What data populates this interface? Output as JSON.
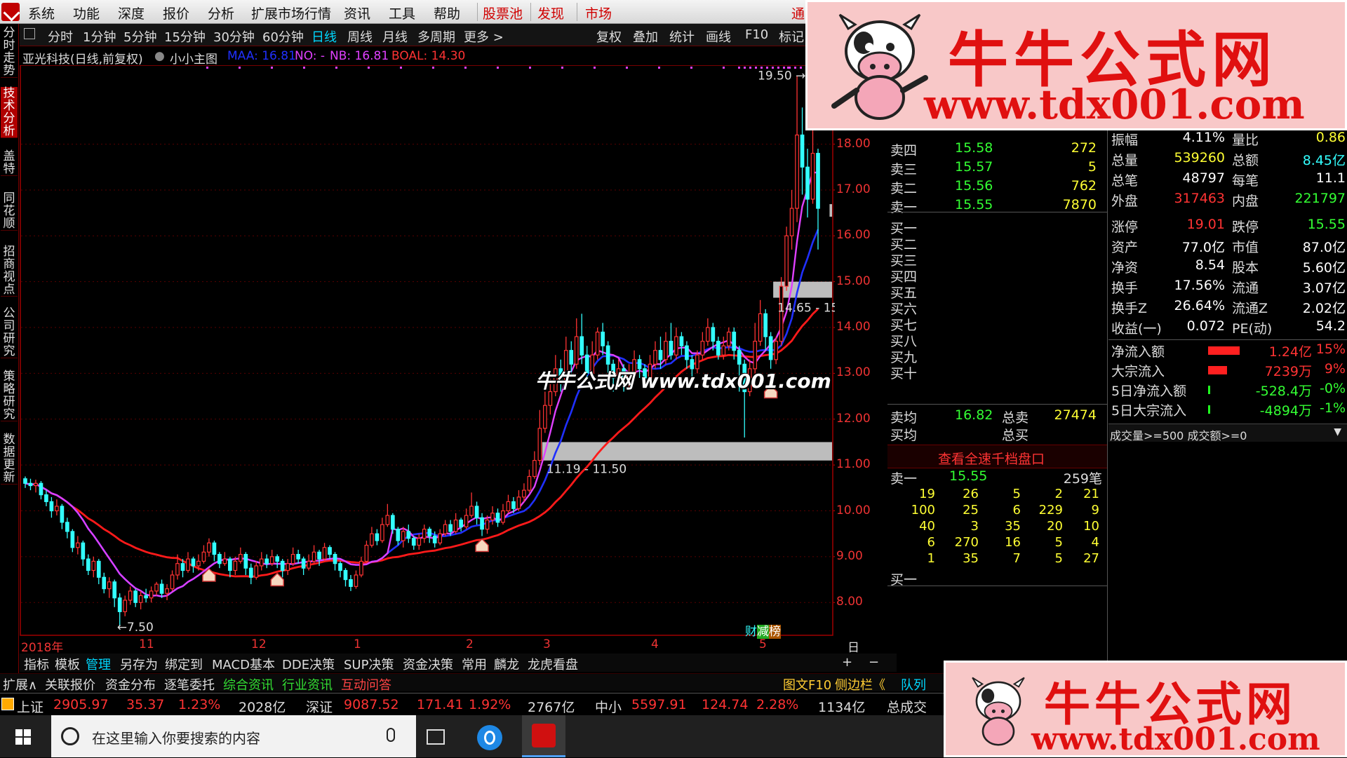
{
  "menu": {
    "items": [
      "系统",
      "功能",
      "深度",
      "报价",
      "分析",
      "扩展市场行情",
      "资讯",
      "工具",
      "帮助"
    ],
    "red_items": [
      "股票池",
      "发现",
      "市场"
    ],
    "right_item": "通"
  },
  "left_tabs": [
    "分时走势",
    "技术分析",
    "盖特",
    "同花顺",
    "招商视点",
    "公司研究",
    "策略研究",
    "数据更新"
  ],
  "period_bar": {
    "items": [
      "分时",
      "1分钟",
      "5分钟",
      "15分钟",
      "30分钟",
      "60分钟",
      "日线",
      "周线",
      "月线",
      "多周期",
      "更多 >"
    ],
    "active": "日线",
    "right_items": [
      "复权",
      "叠加",
      "统计",
      "画线",
      "F10",
      "标记"
    ]
  },
  "chart_title": {
    "stock": "亚光科技(日线,前复权)",
    "indicator": "小小主图",
    "maa": "MAA: 16.81",
    "no": "NO: -",
    "nb": "NB: 16.81",
    "boal": "BOAL: 14.30"
  },
  "colors": {
    "up": "#ff3333",
    "down": "#33ffff",
    "ma_red": "#ff1a1a",
    "ma_blue": "#2030ff",
    "ma_magenta": "#e040ff",
    "zone": "#bdbdbd",
    "accent": "#00d8ff",
    "watermark_red": "#e01010"
  },
  "chart_data": {
    "type": "candlestick",
    "y_axis": {
      "ticks": [
        "18.00",
        "17.00",
        "16.00",
        "15.00",
        "14.00",
        "13.00",
        "12.00",
        "11.00",
        "10.00",
        "9.00",
        "8.00"
      ],
      "range": [
        7.3,
        19.6
      ]
    },
    "x_axis": {
      "labels": [
        "2018年",
        "11",
        "12",
        "1",
        "2",
        "3",
        "4",
        "5"
      ]
    },
    "annotations": {
      "high": "19.50",
      "low": "7.50",
      "zone_low": "11.19 - 11.50",
      "zone_high": "14.65 - 15",
      "last": "16.6"
    },
    "period_label": "日线",
    "candles": [
      [
        10.7,
        10.6,
        10.75,
        10.5
      ],
      [
        10.6,
        10.55,
        10.7,
        10.45
      ],
      [
        10.55,
        10.6,
        10.68,
        10.4
      ],
      [
        10.6,
        10.35,
        10.65,
        10.25
      ],
      [
        10.35,
        10.2,
        10.45,
        10.1
      ],
      [
        10.2,
        10.0,
        10.3,
        9.85
      ],
      [
        10.0,
        10.1,
        10.25,
        9.9
      ],
      [
        10.1,
        9.75,
        10.15,
        9.6
      ],
      [
        9.75,
        9.55,
        9.85,
        9.4
      ],
      [
        9.55,
        9.2,
        9.6,
        9.1
      ],
      [
        9.2,
        9.3,
        9.45,
        9.05
      ],
      [
        9.3,
        8.95,
        9.35,
        8.8
      ],
      [
        8.95,
        8.7,
        9.05,
        8.6
      ],
      [
        8.7,
        8.9,
        9.0,
        8.55
      ],
      [
        8.9,
        8.55,
        8.95,
        8.4
      ],
      [
        8.55,
        8.3,
        8.65,
        8.2
      ],
      [
        8.3,
        8.45,
        8.55,
        8.1
      ],
      [
        8.45,
        8.1,
        8.5,
        7.9
      ],
      [
        8.1,
        7.8,
        8.2,
        7.5
      ],
      [
        7.8,
        8.05,
        8.15,
        7.7
      ],
      [
        8.05,
        8.25,
        8.35,
        7.95
      ],
      [
        8.25,
        8.0,
        8.3,
        7.9
      ],
      [
        8.0,
        8.15,
        8.25,
        7.85
      ],
      [
        8.15,
        8.1,
        8.3,
        8.0
      ],
      [
        8.1,
        8.25,
        8.35,
        8.0
      ],
      [
        8.25,
        8.4,
        8.45,
        8.15
      ],
      [
        8.4,
        8.2,
        8.5,
        8.1
      ],
      [
        8.2,
        8.3,
        8.4,
        8.05
      ],
      [
        8.3,
        8.6,
        8.7,
        8.25
      ],
      [
        8.6,
        8.85,
        9.05,
        8.5
      ],
      [
        8.85,
        8.7,
        8.95,
        8.55
      ],
      [
        8.7,
        8.95,
        9.1,
        8.65
      ],
      [
        8.95,
        8.8,
        9.0,
        8.65
      ],
      [
        8.8,
        8.9,
        9.05,
        8.7
      ],
      [
        8.9,
        9.1,
        9.25,
        8.85
      ],
      [
        9.1,
        9.3,
        9.4,
        9.0
      ],
      [
        9.3,
        9.05,
        9.35,
        8.9
      ],
      [
        9.05,
        8.85,
        9.1,
        8.75
      ],
      [
        8.85,
        8.95,
        9.1,
        8.8
      ],
      [
        8.95,
        8.7,
        9.0,
        8.55
      ],
      [
        8.7,
        8.9,
        9.0,
        8.6
      ],
      [
        8.9,
        9.05,
        9.2,
        8.85
      ],
      [
        9.05,
        8.75,
        9.1,
        8.6
      ],
      [
        8.75,
        8.55,
        8.85,
        8.4
      ],
      [
        8.55,
        8.8,
        8.9,
        8.5
      ],
      [
        8.8,
        8.95,
        9.1,
        8.7
      ],
      [
        8.95,
        8.85,
        9.05,
        8.75
      ],
      [
        8.85,
        9.0,
        9.15,
        8.8
      ],
      [
        9.0,
        8.9,
        9.05,
        8.75
      ],
      [
        8.9,
        8.7,
        8.95,
        8.55
      ],
      [
        8.7,
        8.85,
        8.95,
        8.6
      ],
      [
        8.85,
        9.05,
        9.2,
        8.8
      ],
      [
        9.05,
        8.95,
        9.15,
        8.85
      ],
      [
        8.95,
        8.75,
        9.0,
        8.6
      ],
      [
        8.75,
        8.9,
        9.05,
        8.7
      ],
      [
        8.9,
        9.1,
        9.25,
        8.85
      ],
      [
        9.1,
        8.95,
        9.15,
        8.8
      ],
      [
        8.95,
        9.2,
        9.3,
        8.9
      ],
      [
        9.2,
        9.05,
        9.25,
        8.95
      ],
      [
        9.05,
        8.85,
        9.1,
        8.7
      ],
      [
        8.85,
        8.7,
        8.9,
        8.55
      ],
      [
        8.7,
        8.5,
        8.75,
        8.35
      ],
      [
        8.5,
        8.35,
        8.6,
        8.25
      ],
      [
        8.35,
        8.6,
        8.7,
        8.3
      ],
      [
        8.6,
        8.9,
        9.0,
        8.55
      ],
      [
        8.9,
        9.25,
        9.35,
        8.85
      ],
      [
        9.25,
        9.5,
        9.65,
        9.2
      ],
      [
        9.5,
        9.35,
        9.6,
        9.25
      ],
      [
        9.35,
        9.7,
        9.85,
        9.3
      ],
      [
        9.7,
        9.9,
        10.15,
        9.65
      ],
      [
        9.9,
        9.6,
        9.95,
        9.5
      ],
      [
        9.6,
        9.35,
        9.65,
        9.25
      ],
      [
        9.35,
        9.55,
        9.65,
        9.2
      ],
      [
        9.55,
        9.4,
        9.7,
        9.3
      ],
      [
        9.4,
        9.25,
        9.45,
        9.15
      ],
      [
        9.25,
        9.4,
        9.5,
        9.15
      ],
      [
        9.4,
        9.6,
        9.7,
        9.3
      ],
      [
        9.6,
        9.45,
        9.65,
        9.3
      ],
      [
        9.45,
        9.3,
        9.55,
        9.2
      ],
      [
        9.3,
        9.5,
        9.6,
        9.25
      ],
      [
        9.5,
        9.7,
        9.8,
        9.45
      ],
      [
        9.7,
        9.55,
        9.8,
        9.45
      ],
      [
        9.55,
        9.8,
        9.95,
        9.5
      ],
      [
        9.8,
        9.65,
        9.85,
        9.55
      ],
      [
        9.65,
        9.9,
        10.05,
        9.6
      ],
      [
        9.9,
        10.1,
        10.4,
        9.85
      ],
      [
        10.1,
        9.85,
        10.2,
        9.7
      ],
      [
        9.85,
        9.6,
        9.95,
        9.45
      ],
      [
        9.6,
        9.8,
        9.9,
        9.5
      ],
      [
        9.8,
        9.95,
        10.1,
        9.7
      ],
      [
        9.95,
        9.75,
        10.05,
        9.65
      ],
      [
        9.75,
        10.0,
        10.15,
        9.7
      ],
      [
        10.0,
        10.2,
        10.35,
        9.95
      ],
      [
        10.2,
        10.05,
        10.3,
        9.95
      ],
      [
        10.05,
        10.3,
        10.45,
        10.0
      ],
      [
        10.3,
        10.45,
        10.6,
        10.2
      ],
      [
        10.45,
        10.75,
        10.9,
        10.4
      ],
      [
        10.75,
        11.1,
        11.3,
        10.7
      ],
      [
        11.1,
        11.8,
        12.2,
        11.0
      ],
      [
        11.8,
        12.3,
        12.6,
        11.7
      ],
      [
        12.3,
        12.6,
        12.9,
        12.1
      ],
      [
        12.6,
        13.1,
        13.4,
        12.5
      ],
      [
        13.1,
        12.8,
        13.3,
        12.6
      ],
      [
        12.8,
        13.5,
        13.8,
        12.7
      ],
      [
        13.5,
        13.2,
        13.7,
        12.9
      ],
      [
        13.2,
        13.8,
        14.2,
        13.1
      ],
      [
        13.8,
        13.4,
        14.3,
        13.2
      ],
      [
        13.4,
        13.0,
        13.6,
        12.8
      ],
      [
        13.0,
        13.4,
        13.7,
        12.9
      ],
      [
        13.4,
        13.9,
        14.0,
        13.3
      ],
      [
        13.9,
        13.6,
        14.1,
        13.4
      ],
      [
        13.6,
        13.2,
        13.7,
        13.0
      ],
      [
        13.2,
        12.9,
        13.3,
        12.6
      ],
      [
        12.9,
        13.1,
        13.3,
        12.7
      ],
      [
        13.1,
        12.8,
        13.2,
        12.6
      ],
      [
        12.8,
        13.0,
        13.2,
        12.7
      ],
      [
        13.0,
        13.3,
        13.5,
        12.9
      ],
      [
        13.3,
        13.1,
        13.4,
        12.9
      ],
      [
        13.1,
        12.9,
        13.2,
        12.7
      ],
      [
        12.9,
        13.2,
        13.4,
        12.8
      ],
      [
        13.2,
        13.5,
        13.7,
        13.1
      ],
      [
        13.5,
        13.3,
        13.8,
        13.1
      ],
      [
        13.3,
        13.7,
        13.9,
        13.2
      ],
      [
        13.7,
        13.4,
        14.1,
        13.3
      ],
      [
        13.4,
        13.8,
        14.0,
        13.3
      ],
      [
        13.8,
        13.6,
        13.9,
        13.4
      ],
      [
        13.6,
        13.3,
        13.7,
        13.1
      ],
      [
        13.3,
        13.1,
        13.4,
        12.9
      ],
      [
        13.1,
        13.4,
        13.5,
        13.0
      ],
      [
        13.4,
        13.7,
        13.9,
        13.3
      ],
      [
        13.7,
        14.0,
        14.2,
        13.6
      ],
      [
        14.0,
        13.7,
        14.1,
        13.5
      ],
      [
        13.7,
        13.4,
        13.8,
        13.3
      ],
      [
        13.4,
        13.6,
        13.8,
        13.3
      ],
      [
        13.6,
        13.9,
        14.0,
        13.5
      ],
      [
        13.9,
        13.5,
        14.0,
        13.3
      ],
      [
        13.5,
        13.2,
        13.6,
        12.6
      ],
      [
        13.2,
        12.6,
        13.3,
        11.6
      ],
      [
        12.6,
        13.1,
        13.3,
        12.5
      ],
      [
        13.1,
        13.7,
        14.1,
        13.0
      ],
      [
        13.7,
        14.3,
        14.6,
        13.6
      ],
      [
        14.3,
        13.8,
        14.4,
        13.5
      ],
      [
        13.8,
        13.3,
        13.9,
        13.1
      ],
      [
        13.3,
        13.7,
        13.8,
        13.2
      ],
      [
        13.7,
        14.9,
        15.1,
        13.6
      ],
      [
        14.9,
        16.0,
        16.2,
        14.8
      ],
      [
        16.0,
        16.6,
        17.0,
        15.7
      ],
      [
        16.6,
        18.2,
        19.5,
        16.3
      ],
      [
        18.2,
        17.5,
        18.8,
        16.9
      ],
      [
        17.5,
        16.8,
        17.9,
        16.4
      ],
      [
        16.8,
        17.8,
        18.4,
        16.7
      ],
      [
        17.8,
        16.6,
        17.9,
        15.7
      ]
    ]
  },
  "quote": {
    "sell": [
      {
        "label": "卖四",
        "price": "15.58",
        "vol": "272"
      },
      {
        "label": "卖三",
        "price": "15.57",
        "vol": "5"
      },
      {
        "label": "卖二",
        "price": "15.56",
        "vol": "762"
      },
      {
        "label": "卖一",
        "price": "15.55",
        "vol": "7870"
      }
    ],
    "buy_labels": [
      "买一",
      "买二",
      "买三",
      "买四",
      "买五",
      "买六",
      "买七",
      "买八",
      "买九",
      "买十"
    ],
    "avg_sell_label": "卖均",
    "avg_sell": "16.82",
    "total_sell_label": "总卖",
    "total_sell": "27474",
    "avg_buy_label": "买均",
    "total_buy_label": "总买",
    "link": "查看全速千档盘口",
    "detail_label": "卖一",
    "detail_price": "15.55",
    "detail_count": "259笔",
    "detail_rows": [
      [
        "19",
        "26",
        "5",
        "2",
        "21"
      ],
      [
        "100",
        "25",
        "6",
        "229",
        "9"
      ],
      [
        "40",
        "3",
        "35",
        "20",
        "10"
      ],
      [
        "6",
        "270",
        "16",
        "5",
        "4"
      ],
      [
        "1",
        "35",
        "7",
        "5",
        "27"
      ]
    ],
    "buy1_label": "买一"
  },
  "stats": {
    "rows": [
      {
        "l1": "振幅",
        "v1": "4.11%",
        "l2": "量比",
        "v2": "0.86",
        "c1": "#ffffff",
        "c2": "#ffff33"
      },
      {
        "l1": "总量",
        "v1": "539260",
        "l2": "总额",
        "v2": "8.45亿",
        "c1": "#ffff33",
        "c2": "#33ffff"
      },
      {
        "l1": "总笔",
        "v1": "48797",
        "l2": "每笔",
        "v2": "11.1",
        "c1": "#ffffff",
        "c2": "#ffffff"
      },
      {
        "l1": "外盘",
        "v1": "317463",
        "l2": "内盘",
        "v2": "221797",
        "c1": "#ff3333",
        "c2": "#33ff33"
      },
      {
        "l1": "涨停",
        "v1": "19.01",
        "l2": "跌停",
        "v2": "15.55",
        "c1": "#ff3333",
        "c2": "#33ff33"
      },
      {
        "l1": "资产",
        "v1": "77.0亿",
        "l2": "市值",
        "v2": "87.0亿",
        "c1": "#ffffff",
        "c2": "#ffffff"
      },
      {
        "l1": "净资",
        "v1": "8.54",
        "l2": "股本",
        "v2": "5.60亿",
        "c1": "#ffffff",
        "c2": "#ffffff"
      },
      {
        "l1": "换手",
        "v1": "17.56%",
        "l2": "流通",
        "v2": "3.07亿",
        "c1": "#ffffff",
        "c2": "#ffffff"
      },
      {
        "l1": "换手Z",
        "v1": "26.64%",
        "l2": "流通Z",
        "v2": "2.02亿",
        "c1": "#ffffff",
        "c2": "#ffffff"
      },
      {
        "l1": "收益(一)",
        "v1": "0.072",
        "l2": "PE(动)",
        "v2": "54.2",
        "c1": "#ffffff",
        "c2": "#ffffff"
      }
    ],
    "flows": [
      {
        "label": "净流入额",
        "value": "1.24亿",
        "pct": "15%",
        "bar": "#ff2020",
        "color": "#ff3333",
        "fill": 0.75
      },
      {
        "label": "大宗流入",
        "value": "7239万",
        "pct": "9%",
        "bar": "#ff2020",
        "color": "#ff3333",
        "fill": 0.45
      },
      {
        "label": "5日净流入额",
        "value": "-528.4万",
        "pct": "-0%",
        "bar": "#20ff20",
        "color": "#33ff33",
        "fill": 0.02
      },
      {
        "label": "5日大宗流入",
        "value": "-4894万",
        "pct": "-1%",
        "bar": "#20ff20",
        "color": "#33ff33",
        "fill": 0.05
      }
    ],
    "filter": "成交量>=500 成交额>=0"
  },
  "bottom_tabs": [
    "指标",
    "模板",
    "管理",
    "另存为",
    "绑定到",
    "MACD基本",
    "DDE决策",
    "SUP决策",
    "资金决策",
    "常用",
    "麟龙",
    "龙虎看盘"
  ],
  "bottom_tabs_active": "管理",
  "bottom_tabs_extra": [
    "+",
    "−"
  ],
  "bottom_bar2": {
    "left": [
      "扩展∧",
      "关联报价",
      "资金分布",
      "逐笔委托"
    ],
    "green": [
      "综合资讯",
      "行业资讯"
    ],
    "red": [
      "互动问答"
    ],
    "right": [
      "图文F10",
      "侧边栏《"
    ],
    "queue": "队列"
  },
  "tags": [
    "财",
    "减",
    "榜"
  ],
  "index_bar": {
    "sh": {
      "name": "上证",
      "val": "2905.97",
      "chg": "35.37",
      "pct": "1.23%",
      "amt": "2028亿"
    },
    "sz": {
      "name": "深证",
      "val": "9087.52",
      "chg": "171.41",
      "pct": "1.92%",
      "amt": "2767亿"
    },
    "zx": {
      "name": "中小",
      "val": "5597.91",
      "chg": "124.74",
      "pct": "2.28%",
      "amt": "1134亿"
    },
    "total": "总成交"
  },
  "taskbar": {
    "search_placeholder": "在这里输入你要搜索的内容"
  },
  "watermark": {
    "title": "牛牛公式网",
    "url": "www.tdx001.com",
    "center": "牛牛公式网 www.tdx001.com"
  }
}
